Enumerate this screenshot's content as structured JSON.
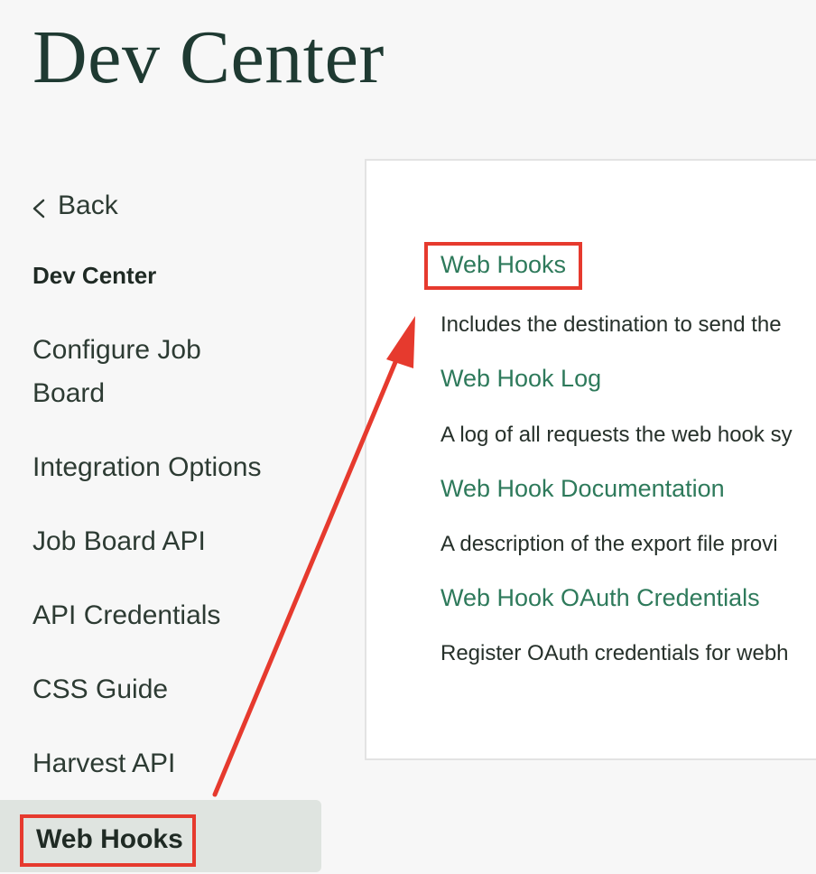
{
  "page": {
    "title": "Dev Center"
  },
  "sidebar": {
    "back_label": "Back",
    "heading": "Dev Center",
    "items": [
      {
        "label": "Configure Job\nBoard"
      },
      {
        "label": "Integration Options"
      },
      {
        "label": "Job Board API"
      },
      {
        "label": "API Credentials"
      },
      {
        "label": "CSS Guide"
      },
      {
        "label": "Harvest API"
      },
      {
        "label": "Web Hooks",
        "active": true
      }
    ]
  },
  "content": {
    "sections": [
      {
        "title": "Web Hooks",
        "description": "Includes the destination to send the"
      },
      {
        "title": "Web Hook Log",
        "description": "A log of all requests the web hook sy"
      },
      {
        "title": "Web Hook Documentation",
        "description": "A description of the export file provi"
      },
      {
        "title": "Web Hook OAuth Credentials",
        "description": "Register OAuth credentials for webh"
      }
    ]
  },
  "annotation": {
    "highlight_color": "#e63a2e"
  },
  "colors": {
    "link": "#2e7a5b",
    "title": "#1f3a32",
    "active_bg": "#dfe4e0",
    "page_bg": "#f7f7f7"
  },
  "icons": {
    "back": "chevron-left-icon"
  }
}
